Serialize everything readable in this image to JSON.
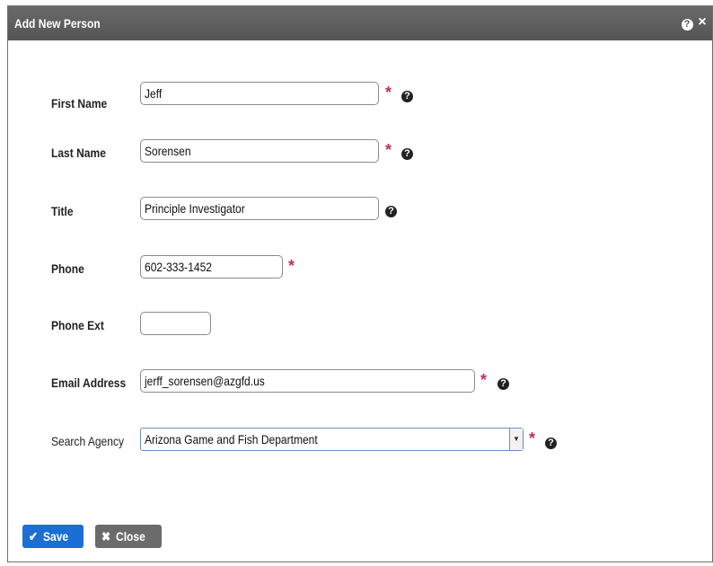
{
  "dialog": {
    "title": "Add New Person",
    "help_glyph": "?",
    "close_glyph": "×"
  },
  "form": {
    "first_name": {
      "label": "First Name",
      "value": "Jeff",
      "required": "*",
      "help": "?"
    },
    "last_name": {
      "label": "Last Name",
      "value": "Sorensen",
      "required": "*",
      "help": "?"
    },
    "title": {
      "label": "Title",
      "value": "Principle Investigator",
      "help": "?"
    },
    "phone": {
      "label": "Phone",
      "value": "602-333-1452",
      "required": "*"
    },
    "phone_ext": {
      "label": "Phone Ext",
      "value": ""
    },
    "email": {
      "label": "Email Address",
      "value": "jerff_sorensen@azgfd.us",
      "required": "*",
      "help": "?"
    },
    "agency": {
      "label": "Search Agency",
      "value": "Arizona Game and Fish Department",
      "arrow": "▼",
      "required": "*",
      "help": "?"
    }
  },
  "footer": {
    "save_icon": "✔",
    "save_label": "Save",
    "close_icon": "✖",
    "close_label": "Close"
  },
  "colors": {
    "titlebar": "#5e5e5e",
    "required": "#c0315a",
    "save": "#1b6fd4",
    "close": "#6b6b6b"
  }
}
